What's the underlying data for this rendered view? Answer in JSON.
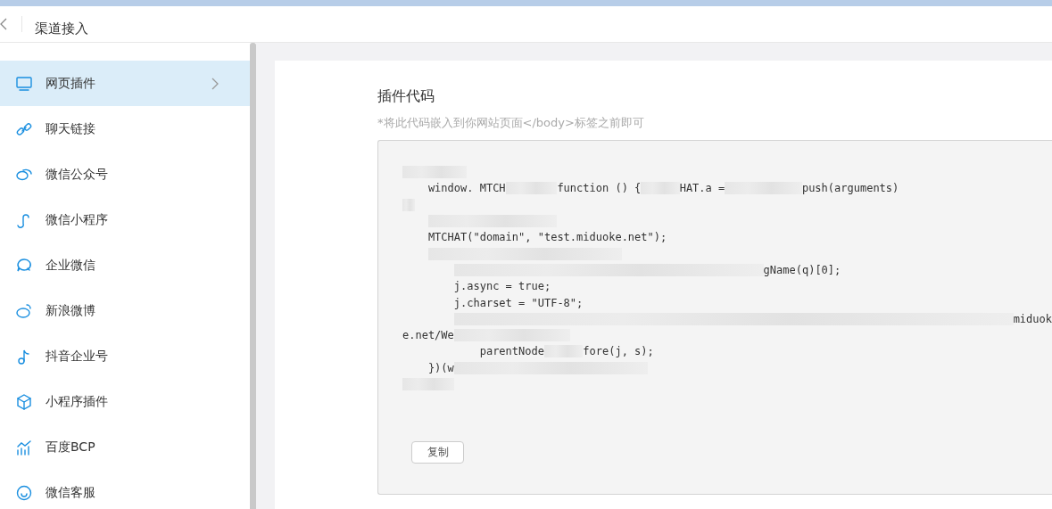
{
  "header": {
    "title": "渠道接入"
  },
  "sidebar": {
    "items": [
      {
        "label": "网页插件",
        "selected": true
      },
      {
        "label": "聊天链接",
        "selected": false
      },
      {
        "label": "微信公众号",
        "selected": false
      },
      {
        "label": "微信小程序",
        "selected": false
      },
      {
        "label": "企业微信",
        "selected": false
      },
      {
        "label": "新浪微博",
        "selected": false
      },
      {
        "label": "抖音企业号",
        "selected": false
      },
      {
        "label": "小程序插件",
        "selected": false
      },
      {
        "label": "百度BCP",
        "selected": false
      },
      {
        "label": "微信客服",
        "selected": false
      }
    ]
  },
  "panel": {
    "title": "插件代码",
    "hint": "*将此代码嵌入到你网站页面</body>标签之前即可",
    "code_lines": [
      [
        {
          "kind": "redacted"
        }
      ],
      [
        {
          "kind": "text",
          "text": "window. MTCH"
        },
        {
          "kind": "redacted"
        },
        {
          "kind": "text",
          "text": "function () {"
        },
        {
          "kind": "redacted"
        },
        {
          "kind": "text",
          "text": "HAT.a ="
        },
        {
          "kind": "redacted"
        },
        {
          "kind": "text",
          "text": "push(arguments)"
        }
      ],
      [
        {
          "kind": "redacted"
        }
      ],
      [
        {
          "kind": "redacted"
        }
      ],
      [
        {
          "kind": "text",
          "text": "MTCHAT(\"domain\", \"test.miduoke.net\");"
        }
      ],
      [
        {
          "kind": "redacted"
        }
      ],
      [
        {
          "kind": "redacted"
        },
        {
          "kind": "text",
          "text": "gName(q)[0];"
        }
      ],
      [
        {
          "kind": "text",
          "text": "j.async = true;"
        }
      ],
      [
        {
          "kind": "text",
          "text": "j.charset = \"UTF-8\";"
        }
      ],
      [
        {
          "kind": "redacted"
        },
        {
          "kind": "text",
          "text": "miduok"
        }
      ],
      [
        {
          "kind": "text",
          "text": "e.net/We"
        },
        {
          "kind": "redacted"
        }
      ],
      [
        {
          "kind": "text",
          "text": "parentNode"
        },
        {
          "kind": "redacted"
        },
        {
          "kind": "text",
          "text": "fore(j, s);"
        }
      ],
      [
        {
          "kind": "text",
          "text": "})(w"
        },
        {
          "kind": "redacted"
        }
      ],
      [
        {
          "kind": "redacted"
        }
      ]
    ],
    "copy_button": "复制"
  }
}
